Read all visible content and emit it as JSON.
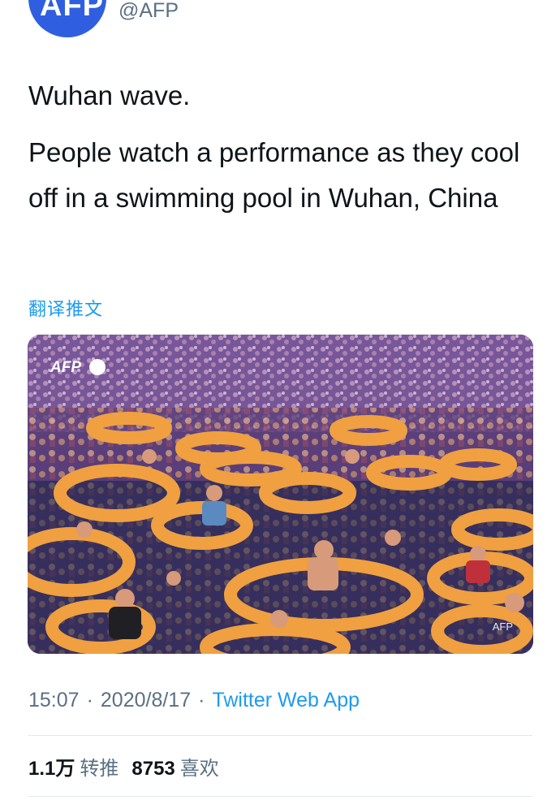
{
  "author": {
    "avatar_text": "AFP",
    "handle": "@AFP"
  },
  "tweet": {
    "line1": "Wuhan wave.",
    "line2": "People watch a performance as they cool off in a swimming pool in Wuhan, China",
    "translate_label": "翻译推文"
  },
  "media": {
    "logo_text": "AFP",
    "credit_text": "AFP"
  },
  "meta": {
    "time": "15:07",
    "date": "2020/8/17",
    "separator": "·",
    "source": "Twitter Web App"
  },
  "stats": {
    "retweets_count": "1.1万",
    "retweets_label": "转推",
    "likes_count": "8753",
    "likes_label": "喜欢"
  },
  "colors": {
    "link": "#1d9bf0",
    "secondary_text": "#5b7083",
    "avatar_bg": "#2f5fe0"
  }
}
